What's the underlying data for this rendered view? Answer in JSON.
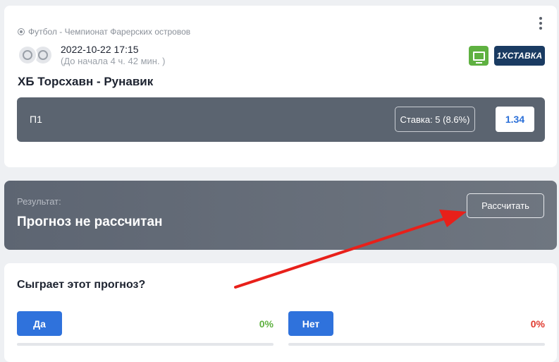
{
  "match": {
    "league": "Футбол - Чемпионат Фарерских островов",
    "datetime": "2022-10-22 17:15",
    "countdown": "(До начала 4 ч. 42 мин. )",
    "title": "ХБ Торсхавн - Рунавик",
    "bookmaker": "1XСТАВКА",
    "bet_type": "П1",
    "stake": "Ставка: 5 (8.6%)",
    "odds": "1.34"
  },
  "result": {
    "label": "Результат:",
    "status": "Прогноз не рассчитан",
    "calc_button": "Рассчитать"
  },
  "poll": {
    "question": "Сыграет этот прогноз?",
    "yes": {
      "label": "Да",
      "percent": "0%",
      "share": 0
    },
    "no": {
      "label": "Нет",
      "percent": "0%",
      "share": 0
    }
  },
  "colors": {
    "accent": "#2f72dc",
    "yes_pct": "#5fb141",
    "no_pct": "#e03a2f",
    "annotation_arrow": "#e8201a"
  }
}
